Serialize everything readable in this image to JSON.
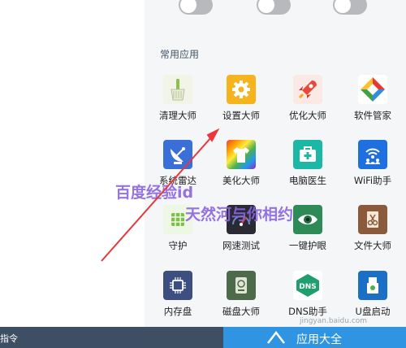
{
  "section_title": "常用应用",
  "apps": [
    {
      "label": "清理大师",
      "icon": "broom-icon"
    },
    {
      "label": "设置大师",
      "icon": "gear-icon"
    },
    {
      "label": "优化大师",
      "icon": "rocket-icon"
    },
    {
      "label": "软件管家",
      "icon": "diamond-icon"
    },
    {
      "label": "系统雷达",
      "icon": "satellite-dish-icon"
    },
    {
      "label": "美化大师",
      "icon": "tshirt-icon"
    },
    {
      "label": "电脑医生",
      "icon": "medical-kit-icon"
    },
    {
      "label": "WiFi助手",
      "icon": "wifi-users-icon"
    },
    {
      "label": "守护",
      "icon": "shield-grid-icon"
    },
    {
      "label": "网速测试",
      "icon": "speedometer-icon"
    },
    {
      "label": "一键护眼",
      "icon": "eye-icon"
    },
    {
      "label": "文件大师",
      "icon": "scissors-file-icon"
    },
    {
      "label": "内存盘",
      "icon": "memory-chip-icon"
    },
    {
      "label": "磁盘大师",
      "icon": "disk-icon"
    },
    {
      "label": "DNS助手",
      "icon": "dns-icon"
    },
    {
      "label": "U盘启动",
      "icon": "usb-drive-icon"
    }
  ],
  "bottombar": {
    "left_text": "指令",
    "right_text": "应用大全"
  },
  "watermark": {
    "line1": "百度经验id",
    "line2": "天然河与你相约",
    "site": "jingyan.baidu.com"
  },
  "colors": {
    "bottom_left": "#3e4e63",
    "bottom_right": "#2f95e3",
    "arrow": "#e8383c"
  }
}
